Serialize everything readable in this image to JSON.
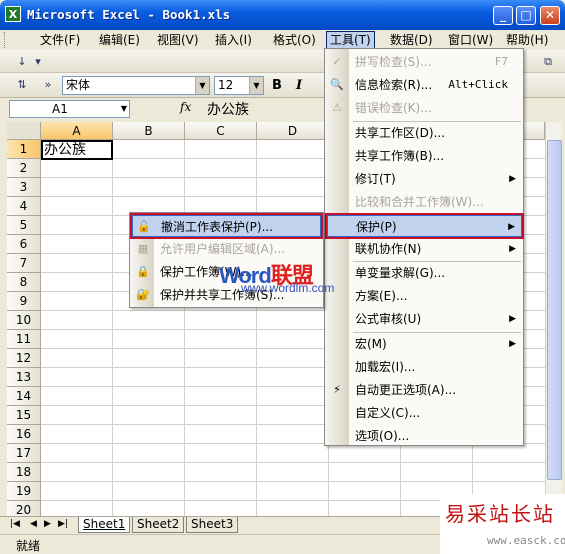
{
  "window": {
    "title": "Microsoft Excel - Book1.xls",
    "minimize": "_",
    "maximize": "□",
    "close": "✕"
  },
  "menubar": {
    "items": [
      "文件(F)",
      "编辑(E)",
      "视图(V)",
      "插入(I)",
      "格式(O)",
      "工具(T)",
      "数据(D)",
      "窗口(W)",
      "帮助(H)"
    ]
  },
  "toolbar": {
    "font_name": "宋体",
    "font_size": "12",
    "bold": "B",
    "italic": "I"
  },
  "formula_bar": {
    "name_box": "A1",
    "fx": "fx",
    "content": "办公族"
  },
  "grid": {
    "columns": [
      "A",
      "B",
      "C",
      "D"
    ],
    "rows": [
      "1",
      "2",
      "3",
      "4",
      "5",
      "6",
      "7",
      "8",
      "9",
      "10",
      "11",
      "12",
      "13",
      "14",
      "15",
      "16",
      "17",
      "18",
      "19",
      "20"
    ],
    "cell_a1": "办公族"
  },
  "tools_menu": {
    "items": [
      {
        "label": "拼写检查(S)...",
        "key": "F7",
        "disabled": true
      },
      {
        "label": "信息检索(R)...",
        "key": "Alt+Click",
        "disabled": false
      },
      {
        "label": "错误检查(K)...",
        "disabled": true
      },
      {
        "label": "共享工作区(D)..."
      },
      {
        "label": "共享工作簿(B)..."
      },
      {
        "label": "修订(T)",
        "submenu": true
      },
      {
        "label": "比较和合并工作簿(W)...",
        "disabled": true
      },
      {
        "label": "保护(P)",
        "submenu": true,
        "highlighted": true
      },
      {
        "label": "联机协作(N)",
        "submenu": true
      },
      {
        "label": "单变量求解(G)..."
      },
      {
        "label": "方案(E)..."
      },
      {
        "label": "公式审核(U)",
        "submenu": true
      },
      {
        "label": "宏(M)",
        "submenu": true
      },
      {
        "label": "加载宏(I)..."
      },
      {
        "label": "自动更正选项(A)..."
      },
      {
        "label": "自定义(C)..."
      },
      {
        "label": "选项(O)..."
      }
    ]
  },
  "protect_menu": {
    "items": [
      {
        "label": "撤消工作表保护(P)...",
        "highlighted": true
      },
      {
        "label": "允许用户编辑区域(A)...",
        "disabled": true
      },
      {
        "label": "保护工作簿(W)..."
      },
      {
        "label": "保护并共享工作簿(S)..."
      }
    ]
  },
  "sheet_tabs": {
    "tabs": [
      "Sheet1",
      "Sheet2",
      "Sheet3"
    ],
    "active": "Sheet1"
  },
  "status": {
    "text": "就绪"
  },
  "watermark": {
    "brand_main": "Word",
    "brand_accent": "联盟",
    "url": "www.wordlm.com"
  },
  "watermark2": {
    "title": "易采站长站",
    "url": "www.easck.com"
  },
  "colors": {
    "highlight_border": "#C8102E",
    "menu_highlight": "#C1D2EE",
    "titlebar": "#0A5DE0"
  }
}
